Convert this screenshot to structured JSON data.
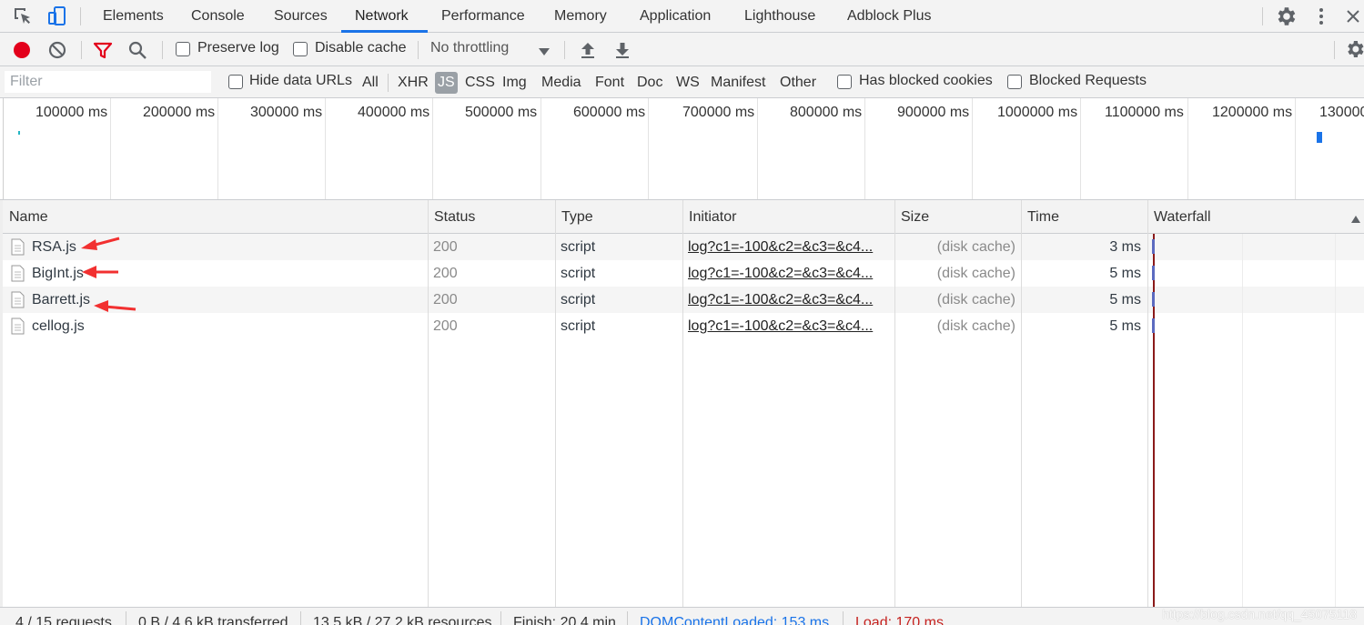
{
  "tabs": [
    "Elements",
    "Console",
    "Sources",
    "Network",
    "Performance",
    "Memory",
    "Application",
    "Lighthouse",
    "Adblock Plus"
  ],
  "active_tab": "Network",
  "toolbar": {
    "preserve_log": "Preserve log",
    "disable_cache": "Disable cache",
    "throttling": "No throttling"
  },
  "filter": {
    "placeholder": "Filter",
    "hide_data_urls": "Hide data URLs",
    "types": [
      "All",
      "XHR",
      "JS",
      "CSS",
      "Img",
      "Media",
      "Font",
      "Doc",
      "WS",
      "Manifest",
      "Other"
    ],
    "active_type": "JS",
    "has_blocked_cookies": "Has blocked cookies",
    "blocked_requests": "Blocked Requests"
  },
  "overview": {
    "ticks": [
      "100000 ms",
      "200000 ms",
      "300000 ms",
      "400000 ms",
      "500000 ms",
      "600000 ms",
      "700000 ms",
      "800000 ms",
      "900000 ms",
      "1000000 ms",
      "1100000 ms",
      "1200000 ms",
      "130000"
    ]
  },
  "columns": [
    "Name",
    "Status",
    "Type",
    "Initiator",
    "Size",
    "Time",
    "Waterfall"
  ],
  "rows": [
    {
      "name": "RSA.js",
      "status": "200",
      "type": "script",
      "initiator": "log?c1=-100&c2=&c3=&c4...",
      "size": "(disk cache)",
      "time": "3 ms"
    },
    {
      "name": "BigInt.js",
      "status": "200",
      "type": "script",
      "initiator": "log?c1=-100&c2=&c3=&c4...",
      "size": "(disk cache)",
      "time": "5 ms"
    },
    {
      "name": "Barrett.js",
      "status": "200",
      "type": "script",
      "initiator": "log?c1=-100&c2=&c3=&c4...",
      "size": "(disk cache)",
      "time": "5 ms"
    },
    {
      "name": "cellog.js",
      "status": "200",
      "type": "script",
      "initiator": "log?c1=-100&c2=&c3=&c4...",
      "size": "(disk cache)",
      "time": "5 ms"
    }
  ],
  "status_bar": {
    "requests": "4 / 15 requests",
    "transferred": "0 B / 4.6 kB transferred",
    "resources": "13.5 kB / 27.2 kB resources",
    "finish": "Finish: 20.4 min",
    "dom_content_loaded": "DOMContentLoaded: 153 ms",
    "load": "Load: 170 ms"
  },
  "watermark": "https://blog.csdn.net/qq_45075118",
  "colors": {
    "record": "#e3001b",
    "active_tab_underline": "#1a73e8",
    "dom_content_loaded": "#1a73e8",
    "load": "#c5221f",
    "annotation_arrow": "#f23030"
  }
}
